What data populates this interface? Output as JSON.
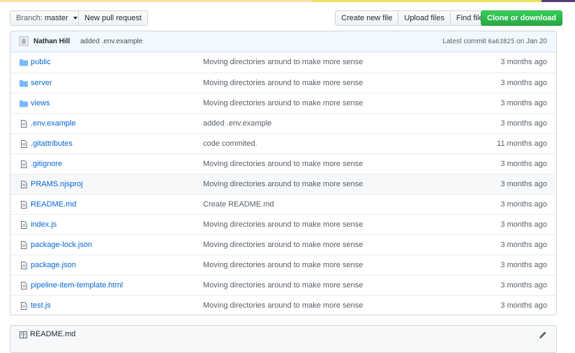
{
  "colors": {
    "topbar": [
      "#f9e2a1",
      "#f1e05a",
      "#563d7c"
    ],
    "link": "#0366d6",
    "green": "#28a745"
  },
  "toolbar": {
    "branch_prefix": "Branch:",
    "branch_name": "master",
    "new_pull_request": "New pull request",
    "create_new_file": "Create new file",
    "upload_files": "Upload files",
    "find_file": "Find file",
    "clone_or_download": "Clone or download"
  },
  "commit": {
    "author": "Nathan Hill",
    "message": "added .env.example",
    "latest_label": "Latest commit",
    "sha": "6a63825",
    "date": "on Jan 20"
  },
  "files": [
    {
      "type": "folder",
      "name": "public",
      "message": "Moving directories around to make more sense",
      "age": "3 months ago"
    },
    {
      "type": "folder",
      "name": "server",
      "message": "Moving directories around to make more sense",
      "age": "3 months ago"
    },
    {
      "type": "folder",
      "name": "views",
      "message": "Moving directories around to make more sense",
      "age": "3 months ago"
    },
    {
      "type": "file",
      "name": ".env.example",
      "message": "added .env.example",
      "age": "3 months ago"
    },
    {
      "type": "file",
      "name": ".gitattributes",
      "message": "code commited.",
      "age": "11 months ago"
    },
    {
      "type": "file",
      "name": ".gitignore",
      "message": "Moving directories around to make more sense",
      "age": "3 months ago"
    },
    {
      "type": "file",
      "name": "PRAMS.njsproj",
      "message": "Moving directories around to make more sense",
      "age": "3 months ago",
      "hover": true
    },
    {
      "type": "file",
      "name": "README.md",
      "message": "Create README.md",
      "age": "3 months ago"
    },
    {
      "type": "file",
      "name": "index.js",
      "message": "Moving directories around to make more sense",
      "age": "3 months ago"
    },
    {
      "type": "file",
      "name": "package-lock.json",
      "message": "Moving directories around to make more sense",
      "age": "3 months ago"
    },
    {
      "type": "file",
      "name": "package.json",
      "message": "Moving directories around to make more sense",
      "age": "3 months ago"
    },
    {
      "type": "file",
      "name": "pipeline-item-template.html",
      "message": "Moving directories around to make more sense",
      "age": "3 months ago"
    },
    {
      "type": "file",
      "name": "test.js",
      "message": "Moving directories around to make more sense",
      "age": "3 months ago"
    }
  ],
  "readme": {
    "title": "README.md",
    "icon": "book-icon",
    "edit_icon": "pencil-icon"
  }
}
